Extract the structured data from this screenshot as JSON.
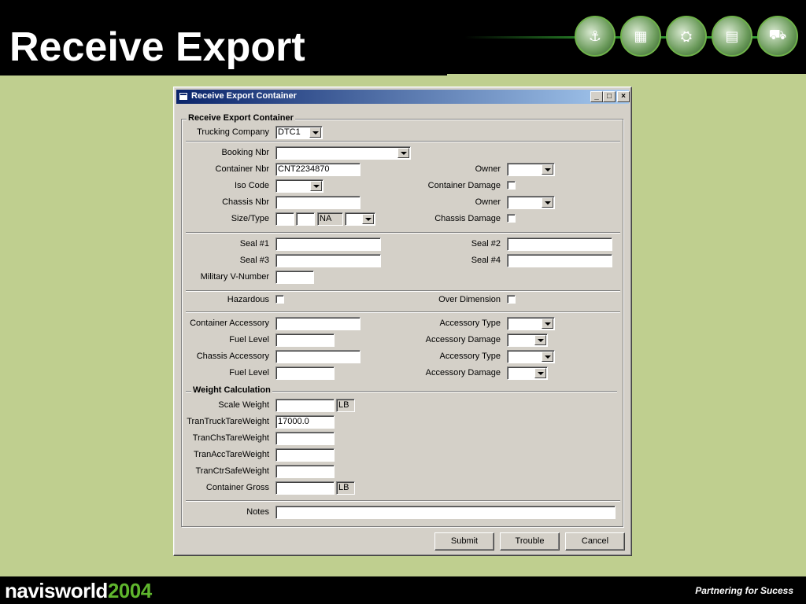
{
  "slide": {
    "title": "Receive Export",
    "logo_white": "navisworld",
    "logo_green": "2004",
    "tagline": "Partnering for Sucess"
  },
  "window": {
    "title": "Receive Export Container",
    "minimize": "_",
    "maximize": "□",
    "close": "×"
  },
  "form": {
    "group_title": "Receive Export Container",
    "trucking_company": {
      "label": "Trucking Company",
      "value": "DTC1"
    },
    "booking_nbr": {
      "label": "Booking Nbr",
      "value": ""
    },
    "container_nbr": {
      "label": "Container Nbr",
      "value": "CNT2234870"
    },
    "owner_1": {
      "label": "Owner",
      "value": ""
    },
    "iso_code": {
      "label": "Iso Code",
      "value": ""
    },
    "container_damage": {
      "label": "Container Damage",
      "checked": false
    },
    "chassis_nbr": {
      "label": "Chassis Nbr",
      "value": ""
    },
    "owner_2": {
      "label": "Owner",
      "value": ""
    },
    "size_type": {
      "label": "Size/Type",
      "size": "",
      "type": "",
      "height": "NA",
      "option": ""
    },
    "chassis_damage": {
      "label": "Chassis Damage",
      "checked": false
    },
    "seal_1": {
      "label": "Seal #1",
      "value": ""
    },
    "seal_2": {
      "label": "Seal #2",
      "value": ""
    },
    "seal_3": {
      "label": "Seal #3",
      "value": ""
    },
    "seal_4": {
      "label": "Seal #4",
      "value": ""
    },
    "military_v_number": {
      "label": "Military V-Number",
      "value": ""
    },
    "hazardous": {
      "label": "Hazardous",
      "checked": false
    },
    "over_dimension": {
      "label": "Over Dimension",
      "checked": false
    },
    "container_accessory": {
      "label": "Container Accessory",
      "value": ""
    },
    "accessory_type_1": {
      "label": "Accessory Type",
      "value": ""
    },
    "fuel_level_1": {
      "label": "Fuel Level",
      "value": ""
    },
    "accessory_damage_1": {
      "label": "Accessory Damage",
      "value": ""
    },
    "chassis_accessory": {
      "label": "Chassis Accessory",
      "value": ""
    },
    "accessory_type_2": {
      "label": "Accessory Type",
      "value": ""
    },
    "fuel_level_2": {
      "label": "Fuel Level",
      "value": ""
    },
    "accessory_damage_2": {
      "label": "Accessory Damage",
      "value": ""
    },
    "weight_title": "Weight Calculation",
    "scale_weight": {
      "label": "Scale Weight",
      "value": "",
      "unit": "LB"
    },
    "tran_truck_tare": {
      "label": "TranTruckTareWeight",
      "value": "17000.0"
    },
    "tran_chs_tare": {
      "label": "TranChsTareWeight",
      "value": ""
    },
    "tran_acc_tare": {
      "label": "TranAccTareWeight",
      "value": ""
    },
    "tran_ctr_safe": {
      "label": "TranCtrSafeWeight",
      "value": ""
    },
    "container_gross": {
      "label": "Container Gross",
      "value": "",
      "unit": "LB"
    },
    "notes": {
      "label": "Notes",
      "value": ""
    }
  },
  "buttons": {
    "submit": "Submit",
    "trouble": "Trouble",
    "cancel": "Cancel"
  }
}
